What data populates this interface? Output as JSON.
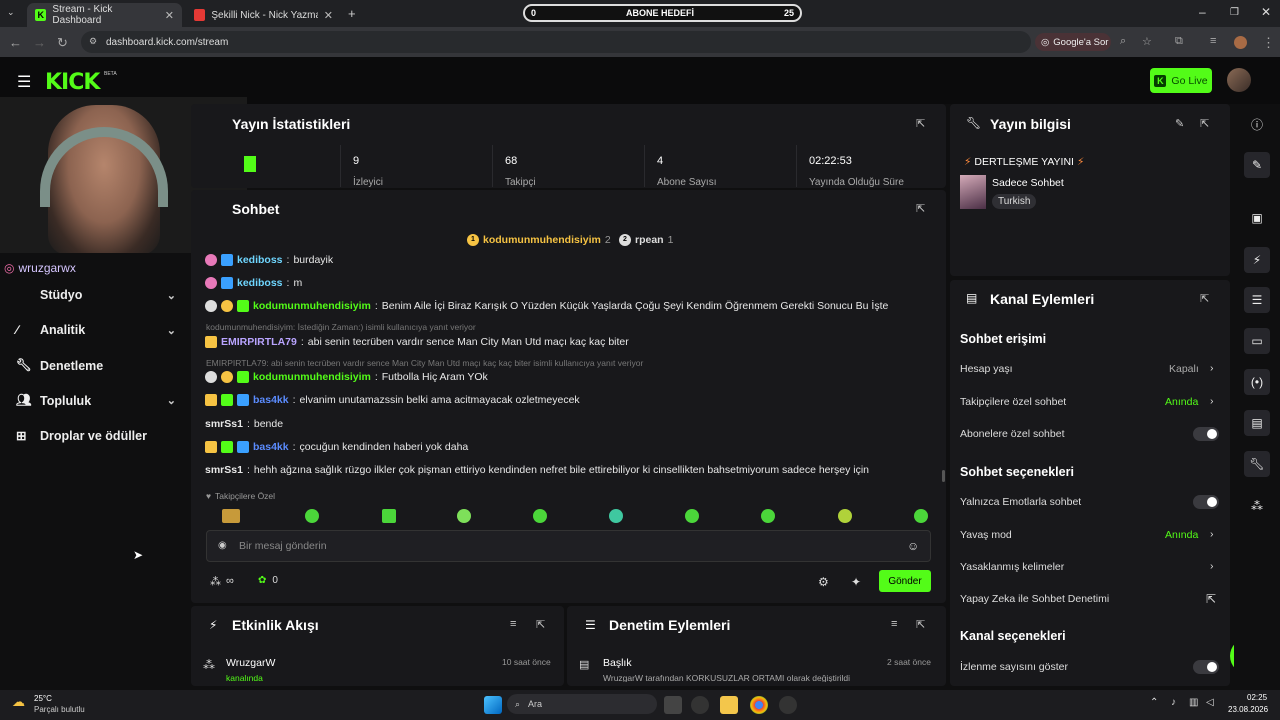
{
  "browser": {
    "tabs": [
      {
        "title": "Stream - Kick Dashboard"
      },
      {
        "title": "Şekilli Nick - Nick Yazma - Şekil"
      }
    ],
    "url": "dashboard.kick.com/stream",
    "google_sor": "Google'a Sor"
  },
  "goal": {
    "left": "0",
    "label": "ABONE HEDEFİ",
    "right": "25"
  },
  "header": {
    "logo": "KICK",
    "beta": "BETA",
    "go_live": "Go Live"
  },
  "overlay": {
    "instagram": "wruzgarwx"
  },
  "sidebar": {
    "items": [
      {
        "label": "Stüdyo",
        "icon": "chevron-down-icon"
      },
      {
        "label": "Analitik",
        "icon": "chevron-down-icon"
      },
      {
        "label": "Denetleme"
      },
      {
        "label": "Topluluk",
        "icon": "chevron-down-icon"
      },
      {
        "label": "Droplar ve ödüller"
      }
    ]
  },
  "stats": {
    "title": "Yayın İstatistikleri",
    "cells": [
      {
        "value": "9",
        "label": "İzleyici"
      },
      {
        "value": "68",
        "label": "Takipçi"
      },
      {
        "value": "4",
        "label": "Abone Sayısı"
      },
      {
        "value": "02:22:53",
        "label": "Yayında Olduğu Süre"
      }
    ]
  },
  "chat": {
    "title": "Sohbet",
    "leaders": [
      {
        "rank": "1",
        "name": "kodumunmuhendisiyim",
        "count": "2"
      },
      {
        "rank": "2",
        "name": "rpean",
        "count": "1"
      }
    ],
    "messages": [
      {
        "user": "kediboss",
        "text": "burdayik"
      },
      {
        "user": "kediboss",
        "text": "m"
      },
      {
        "user": "kodumunmuhendisiyim",
        "text": "Benim Aile İçi Biraz Karışık O Yüzden Küçük Yaşlarda Çoğu Şeyi Kendim Öğrenmem Gerekti Sonucu Bu İşte"
      },
      {
        "reply": "kodumunmuhendisiyim: İstediğin Zaman:) isimli kullanıcıya yanıt veriyor"
      },
      {
        "user": "EMIRPIRTLA79",
        "text": "abi senin tecrüben vardır sence Man City Man Utd maçı kaç kaç biter"
      },
      {
        "reply": "EMIRPIRTLA79: abi senin tecrüben vardır sence Man City Man Utd maçı kaç kaç biter isimli kullanıcıya yanıt veriyor"
      },
      {
        "user": "kodumunmuhendisiyim",
        "text": "Futbolla Hiç Aram YOk"
      },
      {
        "user": "bas4kk",
        "text": "elvanim unutamazssin belki ama acitmayacak ozletmeyecek"
      },
      {
        "user": "smrSs1",
        "text": "bende"
      },
      {
        "user": "bas4kk",
        "text": "çocuğun kendinden haberi yok daha"
      },
      {
        "user": "smrSs1",
        "text": "hehh ağzına sağlık rüzgo ilkler çok pişman ettiriyo kendinden nefret bile ettirebiliyor ki cinsellikten bahsetmiyorum sadece herşey için"
      }
    ],
    "followers_only": "Takipçilere Özel",
    "input_placeholder": "Bir mesaj gönderin",
    "points": "∞",
    "coins": "0",
    "send": "Gönder"
  },
  "activity": {
    "title": "Etkinlik Akışı",
    "item": {
      "user": "WruzgarW",
      "time": "10 saat önce",
      "detail": "kanalında"
    }
  },
  "moderation": {
    "title": "Denetim Eylemleri",
    "item": {
      "label": "Başlık",
      "time": "2 saat önce",
      "detail": "WruzgarW tarafından  KORKUSUZLAR ORTAMI  olarak değiştirildi"
    }
  },
  "stream_info": {
    "title": "Yayın bilgisi",
    "stream_title": "DERTLEŞME YAYINI",
    "category": "Sadece Sohbet",
    "language": "Turkish"
  },
  "channel_actions": {
    "title": "Kanal Eylemleri",
    "sections": [
      {
        "heading": "Sohbet erişimi"
      },
      {
        "heading": "Sohbet seçenekleri"
      },
      {
        "heading": "Kanal seçenekleri"
      }
    ],
    "rows": [
      {
        "label": "Hesap yaşı",
        "value": "Kapalı"
      },
      {
        "label": "Takipçilere özel sohbet",
        "value": "Anında"
      },
      {
        "label": "Abonelere özel sohbet"
      },
      {
        "label": "Yalnızca Emotlarla sohbet"
      },
      {
        "label": "Yavaş mod",
        "value": "Anında"
      },
      {
        "label": "Yasaklanmış kelimeler"
      },
      {
        "label": "Yapay Zeka ile Sohbet Denetimi"
      },
      {
        "label": "İzlenme sayısını göster"
      }
    ]
  },
  "taskbar": {
    "weather_temp": "25°C",
    "weather_desc": "Parçalı bulutlu",
    "search": "Ara",
    "time": "02:25",
    "date": "23.08.2026"
  },
  "colors": {
    "brand": "#53fc18",
    "panel": "#18181b",
    "bg": "#0f0f10"
  }
}
